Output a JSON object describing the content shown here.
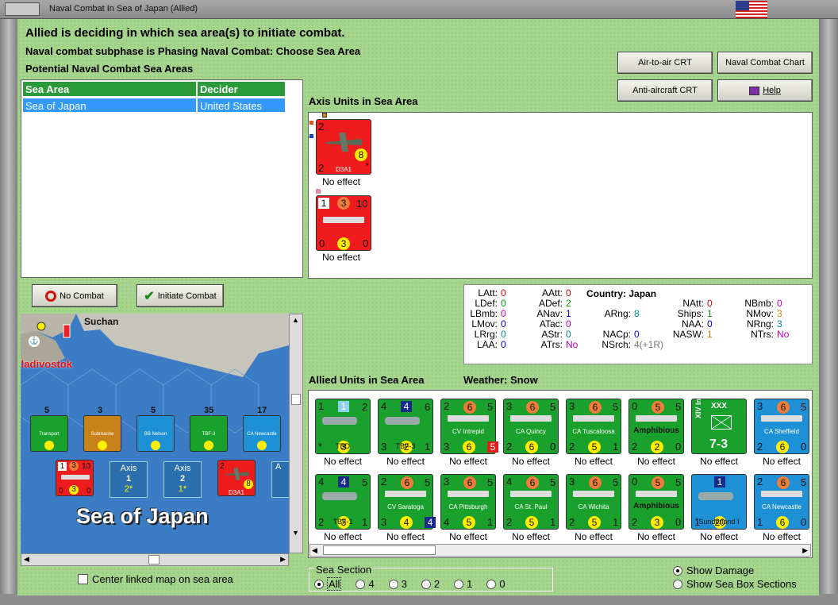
{
  "window": {
    "title": "Naval Combat In Sea of Japan (Allied)"
  },
  "status": {
    "line1": "Allied is deciding in which sea area(s) to initiate combat.",
    "line2": "Naval combat subphase is Phasing Naval Combat: Choose Sea Area",
    "line3": "Potential Naval Combat Sea Areas"
  },
  "buttons": {
    "air_to_air": "Air-to-air CRT",
    "naval_chart": "Naval Combat Chart",
    "anti_aircraft": "Anti-aircraft CRT",
    "help": "Help",
    "no_combat": "No Combat",
    "initiate": "Initiate Combat"
  },
  "sea_table": {
    "headers": [
      "Sea Area",
      "Decider"
    ],
    "rows": [
      [
        "Sea of Japan",
        "United States"
      ]
    ]
  },
  "axis": {
    "heading": "Axis Units in Sea Area",
    "units": [
      {
        "tl": "2",
        "tr": "",
        "bl": "2",
        "mid": "8",
        "br": "*",
        "name": "D3A1",
        "effect": "No effect"
      },
      {
        "tl": "1",
        "tm": "3",
        "tr": "10",
        "bl": "0",
        "mid": "3",
        "br": "0",
        "name": "",
        "effect": "No effect"
      }
    ]
  },
  "info": {
    "country_label": "Country:",
    "country": "Japan",
    "col1": [
      [
        "LAtt:",
        "0"
      ],
      [
        "LDef:",
        "0"
      ],
      [
        "LBmb:",
        "0"
      ],
      [
        "LMov:",
        "0"
      ],
      [
        "LRrg:",
        "0"
      ],
      [
        "LAA:",
        "0"
      ]
    ],
    "col2": [
      [
        "AAtt:",
        "0"
      ],
      [
        "ADef:",
        "2"
      ],
      [
        "ANav:",
        "1"
      ],
      [
        "ATac:",
        "0"
      ],
      [
        "AStr:",
        "0"
      ],
      [
        "ATrs:",
        "No"
      ]
    ],
    "col3": [
      [
        "ARng:",
        "8"
      ],
      [
        "NACp:",
        "0"
      ],
      [
        "NSrch:",
        "4(+1R)"
      ]
    ],
    "col4": [
      [
        "NAtt:",
        "0"
      ],
      [
        "Ships:",
        "1"
      ],
      [
        "NAA:",
        "0"
      ],
      [
        "NASW:",
        "1"
      ]
    ],
    "col5": [
      [
        "NBmb:",
        "0"
      ],
      [
        "NMov:",
        "3"
      ],
      [
        "NRng:",
        "3"
      ],
      [
        "NTrs:",
        "No"
      ]
    ]
  },
  "allied": {
    "heading": "Allied Units in Sea Area",
    "weather_label": "Weather:",
    "weather": "Snow",
    "row1": [
      {
        "tl": "1",
        "tm": "1",
        "tr": "2",
        "bl": "*",
        "mid": "3",
        "br": "",
        "name": "TBD",
        "effect": "No effect",
        "color": "green"
      },
      {
        "tl": "4",
        "tm": "4",
        "tr": "6",
        "bl": "3",
        "mid": "2",
        "br": "1",
        "name": "TBF-3",
        "effect": "No effect",
        "color": "green"
      },
      {
        "tl": "2",
        "tm": "6",
        "tr": "5",
        "bl": "3",
        "mid": "6",
        "br": "5",
        "name": "CV Intrepid",
        "effect": "No effect",
        "color": "green"
      },
      {
        "tl": "3",
        "tm": "6",
        "tr": "5",
        "bl": "2",
        "mid": "6",
        "br": "0",
        "name": "CA Quincy",
        "effect": "No effect",
        "color": "green"
      },
      {
        "tl": "3",
        "tm": "6",
        "tr": "5",
        "bl": "2",
        "mid": "5",
        "br": "1",
        "name": "CA Tuscaloosa",
        "effect": "No effect",
        "color": "green"
      },
      {
        "tl": "0",
        "tm": "5",
        "tr": "5",
        "bl": "2",
        "mid": "2",
        "br": "0",
        "name": "Amphibious",
        "effect": "No effect",
        "color": "green"
      },
      {
        "tl": "",
        "tm": "XXX",
        "tr": "",
        "bl": "",
        "mid": "7-3",
        "br": "",
        "name": "XIV Inf",
        "effect": "No effect",
        "color": "green"
      },
      {
        "tl": "3",
        "tm": "6",
        "tr": "5",
        "bl": "2",
        "mid": "6",
        "br": "0",
        "name": "CA Sheffield",
        "effect": "No effect",
        "color": "blue"
      }
    ],
    "row2": [
      {
        "tl": "4",
        "tm": "4",
        "tr": "5",
        "bl": "2",
        "mid": "3",
        "br": "1",
        "name": "TBF-1",
        "effect": "No effect",
        "color": "green"
      },
      {
        "tl": "2",
        "tm": "6",
        "tr": "5",
        "bl": "3",
        "mid": "4",
        "br": "4",
        "name": "CV Saratoga",
        "effect": "No effect",
        "color": "green"
      },
      {
        "tl": "3",
        "tm": "6",
        "tr": "5",
        "bl": "4",
        "mid": "5",
        "br": "1",
        "name": "CA Pittsburgh",
        "effect": "No effect",
        "color": "green"
      },
      {
        "tl": "4",
        "tm": "6",
        "tr": "5",
        "bl": "2",
        "mid": "5",
        "br": "1",
        "name": "CA St. Paul",
        "effect": "No effect",
        "color": "green"
      },
      {
        "tl": "3",
        "tm": "6",
        "tr": "5",
        "bl": "2",
        "mid": "5",
        "br": "1",
        "name": "CA Wichita",
        "effect": "No effect",
        "color": "green"
      },
      {
        "tl": "0",
        "tm": "5",
        "tr": "5",
        "bl": "2",
        "mid": "3",
        "br": "0",
        "name": "Amphibious",
        "effect": "No effect",
        "color": "green"
      },
      {
        "tl": "",
        "tm": "1",
        "tr": "",
        "bl": "1",
        "mid": "20",
        "br": "",
        "name": "Sunderland I",
        "effect": "No effect",
        "color": "blue"
      },
      {
        "tl": "2",
        "tm": "6",
        "tr": "5",
        "bl": "1",
        "mid": "6",
        "br": "0",
        "name": "CA Newcastle",
        "effect": "No effect",
        "color": "blue"
      }
    ]
  },
  "map": {
    "city1": "Suchan",
    "city2": "Vladivostok",
    "sea_label": "Sea of Japan",
    "stack_counts": [
      "5",
      "3",
      "5",
      "35",
      "17"
    ],
    "stack_names": [
      "Transport",
      "Submarine",
      "BB Nelson",
      "TBF-3",
      "CA Newcastle"
    ],
    "box_labels": [
      [
        "Axis",
        "1",
        "2*"
      ],
      [
        "Axis",
        "2",
        "1*"
      ]
    ],
    "red_unit_name": "D3A1"
  },
  "bottom": {
    "center_map": "Center linked map on sea area",
    "sea_section_label": "Sea Section",
    "sections": [
      "All",
      "4",
      "3",
      "2",
      "1",
      "0"
    ],
    "show_damage": "Show Damage",
    "show_boxes": "Show Sea Box Sections"
  }
}
